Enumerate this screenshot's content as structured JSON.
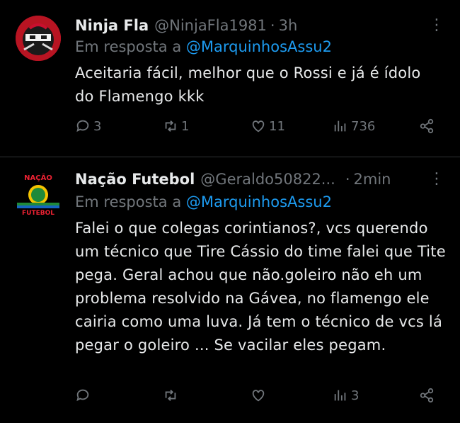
{
  "tweets": [
    {
      "name": "Ninja Fla",
      "handle": "@NinjaFla1981",
      "time": "3h",
      "reply_prefix": "Em resposta a",
      "reply_to": "@MarquinhosAssu2",
      "text": "Aceitaria fácil, melhor que o Rossi e já é ídolo do Flamengo kkk",
      "replies": "3",
      "retweets": "1",
      "likes": "11",
      "views": "736"
    },
    {
      "name": "Nação Futebol",
      "handle": "@Geraldo50822...",
      "time": "2min",
      "reply_prefix": "Em resposta a",
      "reply_to": "@MarquinhosAssu2",
      "text": "Falei o que colegas corintianos?, vcs querendo um técnico que Tire Cássio do time falei que Tite pega. Geral achou que não.goleiro não eh um problema resolvido na Gávea, no flamengo ele cairia como uma luva. Já tem o técnico de vcs lá pegar o goleiro ... Se vacilar eles pegam.",
      "replies": "",
      "retweets": "",
      "likes": "",
      "views": "3"
    }
  ],
  "avatar2_text_top": "NAÇÃO",
  "avatar2_text_bottom": "FUTEBOL",
  "colors": {
    "background": "#000000",
    "link": "#1d9bf0",
    "muted": "#71767b",
    "text": "#e7e9ea",
    "divider": "#2f3336"
  }
}
